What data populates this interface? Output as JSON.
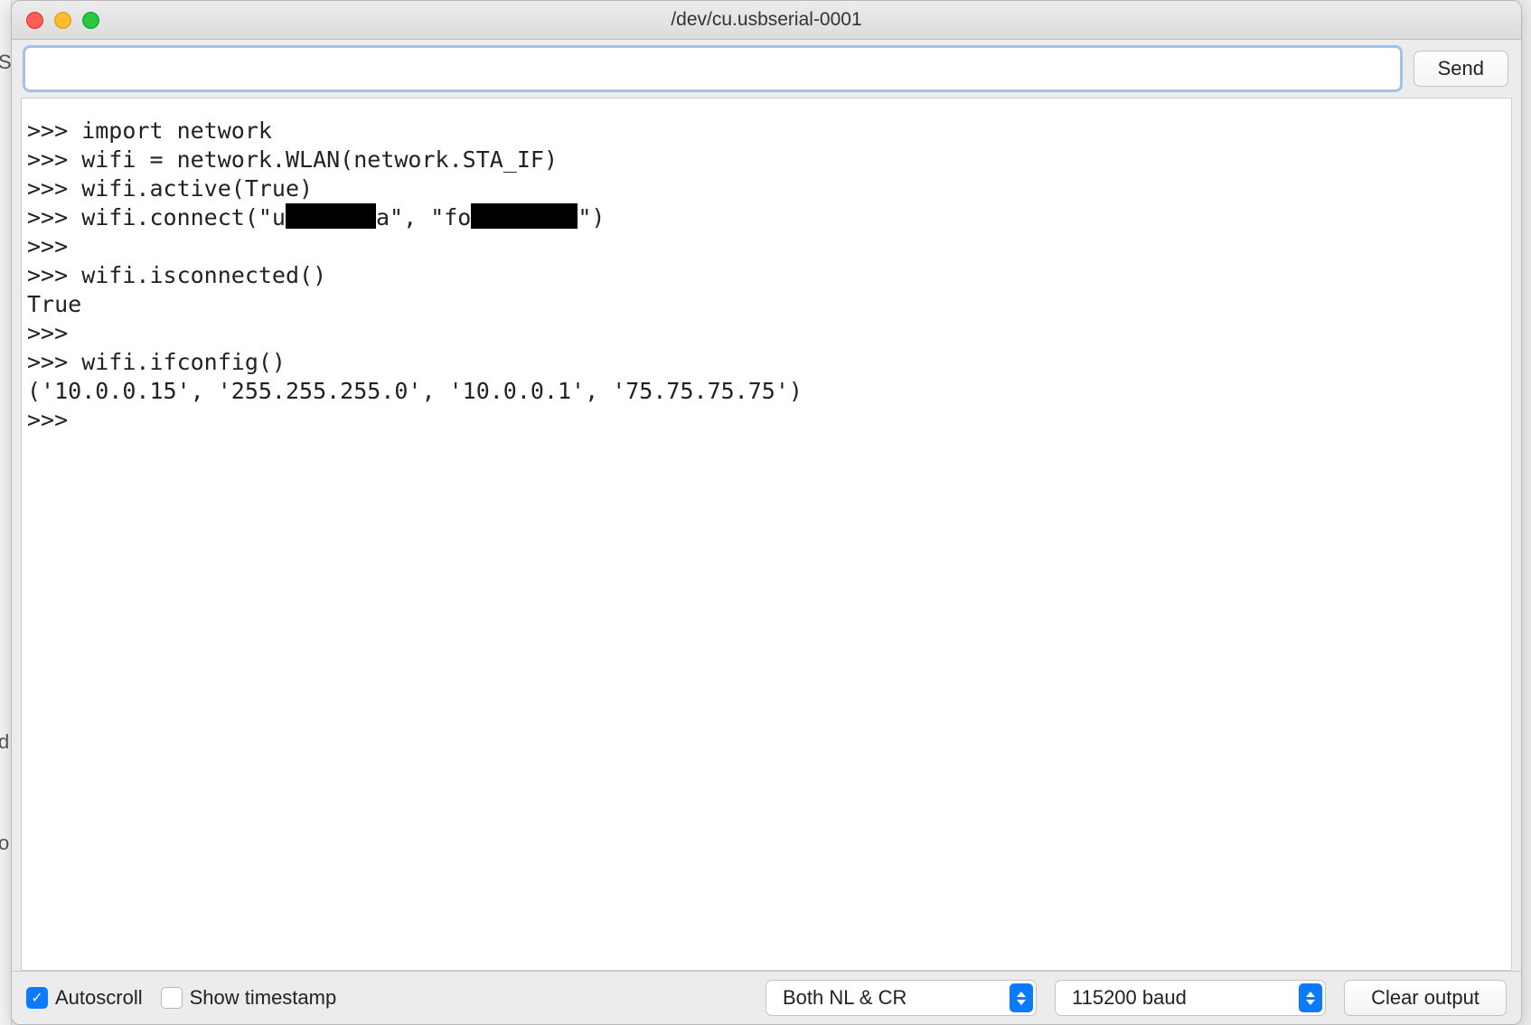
{
  "window": {
    "title": "/dev/cu.usbserial-0001"
  },
  "toolbar": {
    "input_value": "",
    "send_label": "Send"
  },
  "console": {
    "lines": [
      {
        "pre": ">>> import network"
      },
      {
        "pre": ">>> wifi = network.WLAN(network.STA_IF)"
      },
      {
        "pre": ">>> wifi.active(True)"
      },
      {
        "pre": ">>> wifi.connect(\"u",
        "redact1_w": 100,
        "mid1": "a\", \"fo",
        "redact2_w": 118,
        "post": "\")"
      },
      {
        "pre": ">>>"
      },
      {
        "pre": ">>> wifi.isconnected()"
      },
      {
        "pre": "True"
      },
      {
        "pre": ">>>"
      },
      {
        "pre": ">>> wifi.ifconfig()"
      },
      {
        "pre": "('10.0.0.15', '255.255.255.0', '10.0.0.1', '75.75.75.75')"
      },
      {
        "pre": ">>>"
      }
    ]
  },
  "footer": {
    "autoscroll": {
      "label": "Autoscroll",
      "checked": true
    },
    "show_timestamp": {
      "label": "Show timestamp",
      "checked": false
    },
    "line_ending": {
      "selected": "Both NL & CR"
    },
    "baud": {
      "selected": "115200 baud"
    },
    "clear_label": "Clear output"
  },
  "bg_letters": [
    "S",
    "d",
    "o"
  ]
}
